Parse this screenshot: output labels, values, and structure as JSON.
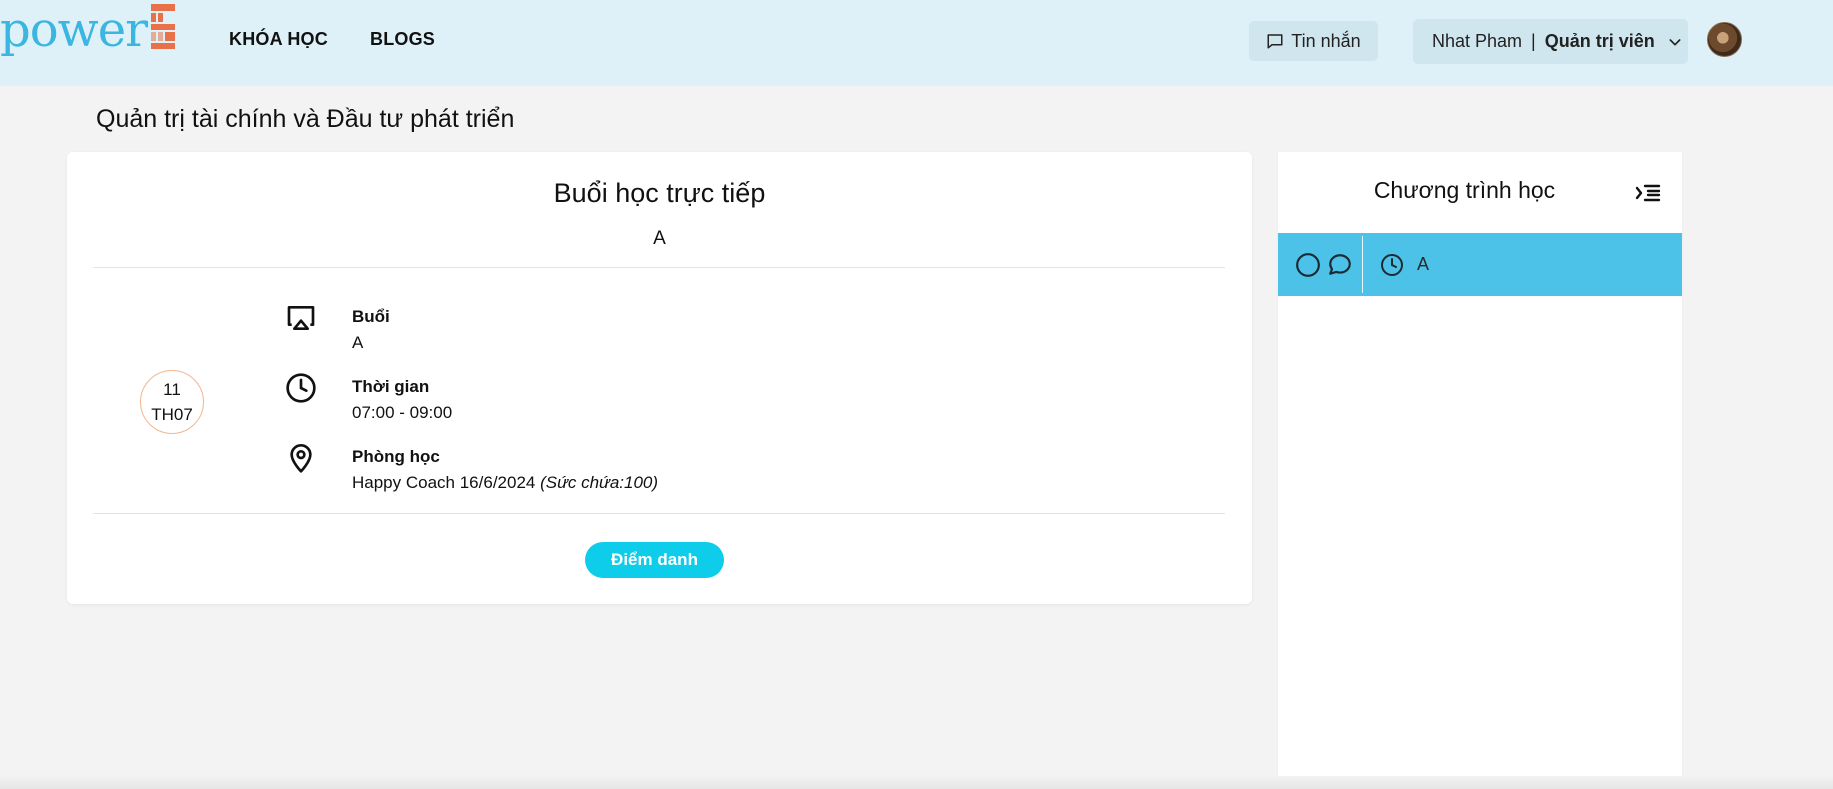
{
  "header": {
    "logo_text": "power",
    "logo_digit": "5",
    "nav": [
      {
        "label": "KHÓA HỌC"
      },
      {
        "label": "BLOGS"
      }
    ],
    "messages_label": "Tin nhắn",
    "user_name": "Nhat Pham",
    "user_separator": "|",
    "user_role": "Quản trị viên"
  },
  "page": {
    "title": "Quản trị tài chính và Đầu tư phát triển"
  },
  "session": {
    "heading": "Buổi học trực tiếp",
    "subtitle": "A",
    "date_day": "11",
    "date_month": "TH07",
    "session_label": "Buổi",
    "session_value": "A",
    "time_label": "Thời gian",
    "time_value": "07:00 - 09:00",
    "room_label": "Phòng học",
    "room_value": "Happy Coach 16/6/2024",
    "room_capacity": "(Sức chứa:100)",
    "attendance_button": "Điểm danh"
  },
  "curriculum": {
    "title": "Chương trình học",
    "items": [
      {
        "label": "A"
      }
    ]
  },
  "colors": {
    "header_bg": "#dff1f8",
    "accent_button": "#0dcdea",
    "active_row": "#4cc2e8",
    "date_ring": "#f3b58f",
    "logo_blue": "#3ab6e0",
    "logo_orange": "#e8714a"
  }
}
